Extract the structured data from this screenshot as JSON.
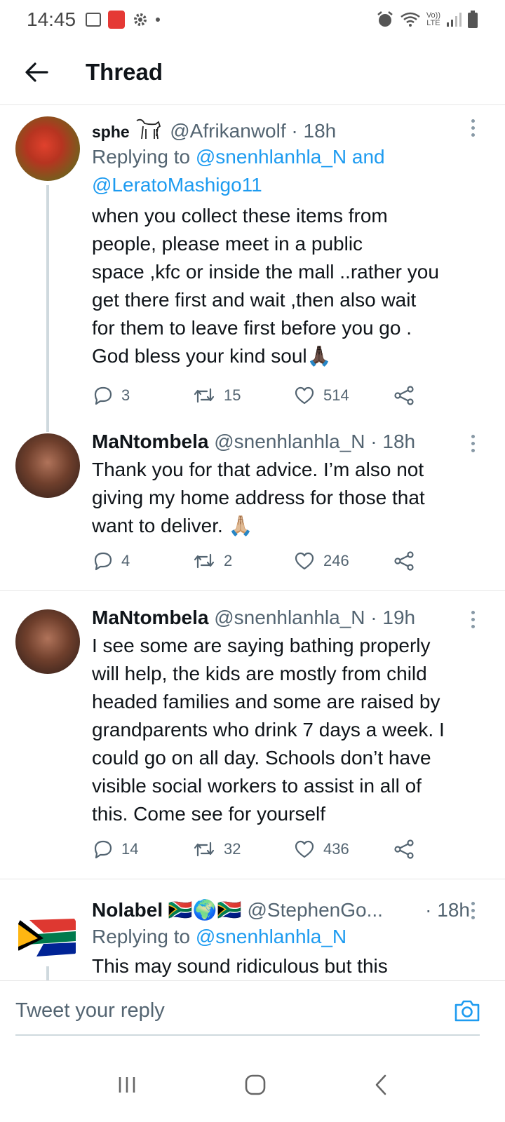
{
  "status_bar": {
    "time": "14:45",
    "lte_top": "Vo))",
    "lte_bottom": "LTE"
  },
  "header": {
    "title": "Thread"
  },
  "tweets": [
    {
      "name": "sphe",
      "handle": "@Afrikanwolf · 18h",
      "replying_prefix": "Replying to",
      "replying_mentions": [
        "@snenhlanhla_N",
        "@LeratoMashigo11"
      ],
      "replying_and": "and",
      "text_lines": [
        "when you collect these items from",
        "people, please meet in a public",
        "space ,kfc or inside the mall ..rather you",
        "get there first and wait ,then also wait",
        "for them to leave first before you go .",
        "God bless your kind soul🙏🏿"
      ],
      "replies": "3",
      "retweets": "15",
      "likes": "514"
    },
    {
      "name": "MaNtombela",
      "handle": "@snenhlanhla_N · 18h",
      "text_lines": [
        "Thank you for that advice. I’m also not",
        "giving my home address for those that",
        "want to deliver. 🙏🏼"
      ],
      "replies": "4",
      "retweets": "2",
      "likes": "246"
    },
    {
      "name": "MaNtombela",
      "handle": "@snenhlanhla_N · 19h",
      "text_lines": [
        "I see some are saying bathing properly",
        "will help, the kids are mostly from child",
        "headed families and some are raised by",
        "grandparents who drink 7 days a week. I",
        "could go on all day. Schools don’t have",
        "visible social workers to assist in all of",
        "this. Come see for yourself"
      ],
      "replies": "14",
      "retweets": "32",
      "likes": "436"
    },
    {
      "name": "Nolabel 🇿🇦🌍🇿🇦",
      "handle": "@StephenGo...",
      "time": "· 18h",
      "replying_prefix": "Replying to",
      "replying_mentions": [
        "@snenhlanhla_N"
      ],
      "text_lines": [
        "This may sound ridiculous but this"
      ]
    }
  ],
  "reply_bar": {
    "placeholder": "Tweet your reply"
  },
  "colors": {
    "accent": "#1d9bf0",
    "muted": "#536471",
    "text": "#0f1419"
  }
}
